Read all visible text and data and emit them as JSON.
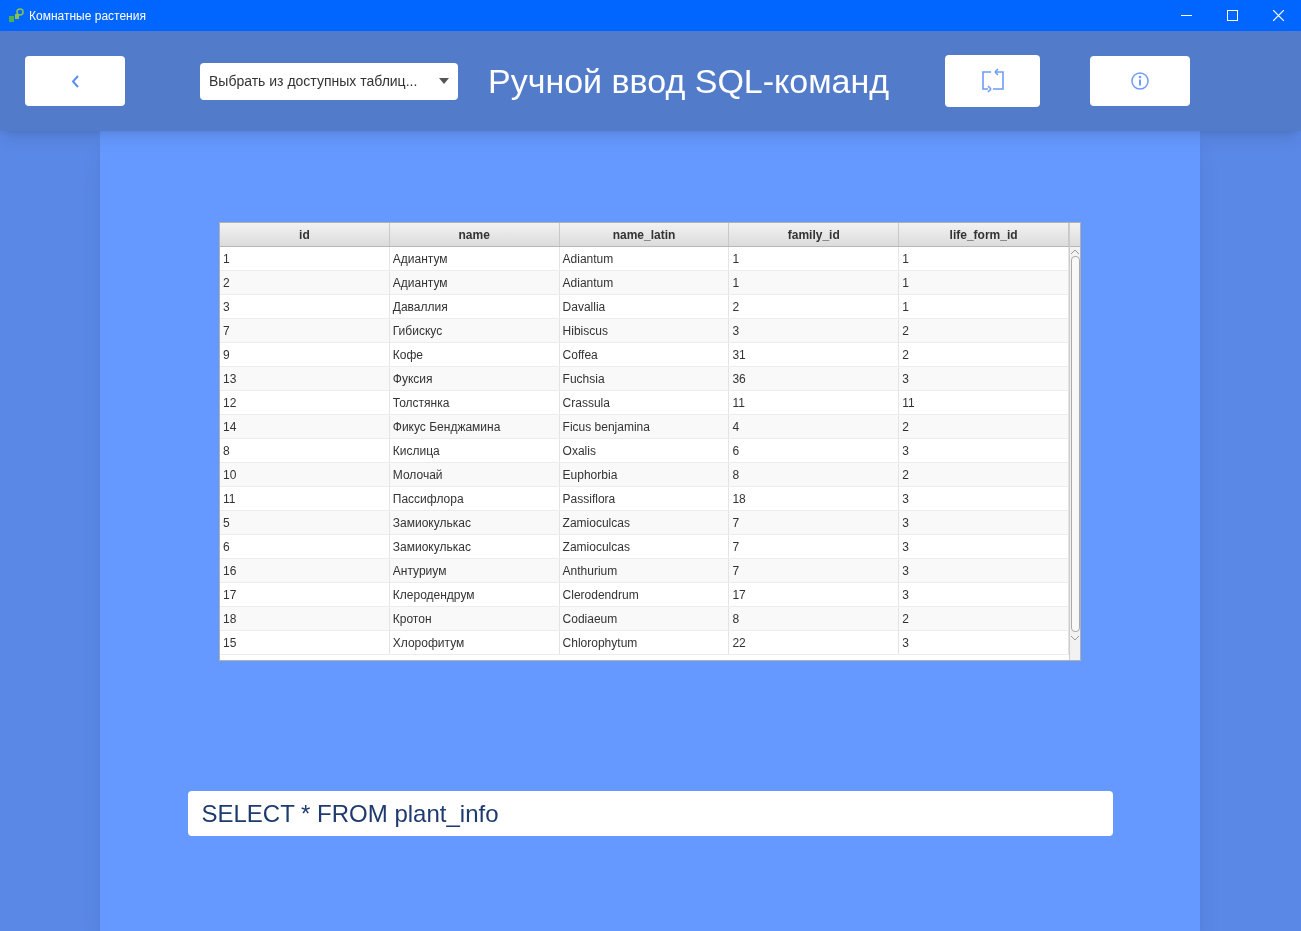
{
  "window": {
    "title": "Комнатные растения"
  },
  "header": {
    "table_select": {
      "value": "Выбрать из доступных таблиц..."
    },
    "title": "Ручной ввод SQL-команд"
  },
  "table": {
    "columns": [
      "id",
      "name",
      "name_latin",
      "family_id",
      "life_form_id"
    ],
    "rows": [
      [
        "1",
        "Адиантум",
        "Adiantum",
        "1",
        "1"
      ],
      [
        "2",
        "Адиантум",
        "Adiantum",
        "1",
        "1"
      ],
      [
        "3",
        "Даваллия",
        "Davallia",
        "2",
        "1"
      ],
      [
        "7",
        "Гибискус",
        "Hibiscus",
        "3",
        "2"
      ],
      [
        "9",
        "Кофе",
        "Coffea",
        "31",
        "2"
      ],
      [
        "13",
        "Фуксия",
        "Fuchsia",
        "36",
        "3"
      ],
      [
        "12",
        "Толстянка",
        "Crassula",
        "11",
        "11"
      ],
      [
        "14",
        "Фикус Бенджамина",
        "Ficus benjamina",
        "4",
        "2"
      ],
      [
        "8",
        "Кислица",
        "Oxalis",
        "6",
        "3"
      ],
      [
        "10",
        "Молочай",
        "Euphorbia",
        "8",
        "2"
      ],
      [
        "11",
        "Пассифлора",
        "Passiflora",
        "18",
        "3"
      ],
      [
        "5",
        "Замиокулькас",
        "Zamioculcas",
        "7",
        "3"
      ],
      [
        "6",
        "Замиокулькас",
        "Zamioculcas",
        "7",
        "3"
      ],
      [
        "16",
        "Антуриум",
        "Anthurium",
        "7",
        "3"
      ],
      [
        "17",
        "Клеродендрум",
        "Clerodendrum",
        "17",
        "3"
      ],
      [
        "18",
        "Кротон",
        "Codiaeum",
        "8",
        "2"
      ],
      [
        "15",
        "Хлорофитум",
        "Chlorophytum",
        "22",
        "3"
      ]
    ]
  },
  "sql_input": {
    "value": "SELECT * FROM plant_info"
  }
}
